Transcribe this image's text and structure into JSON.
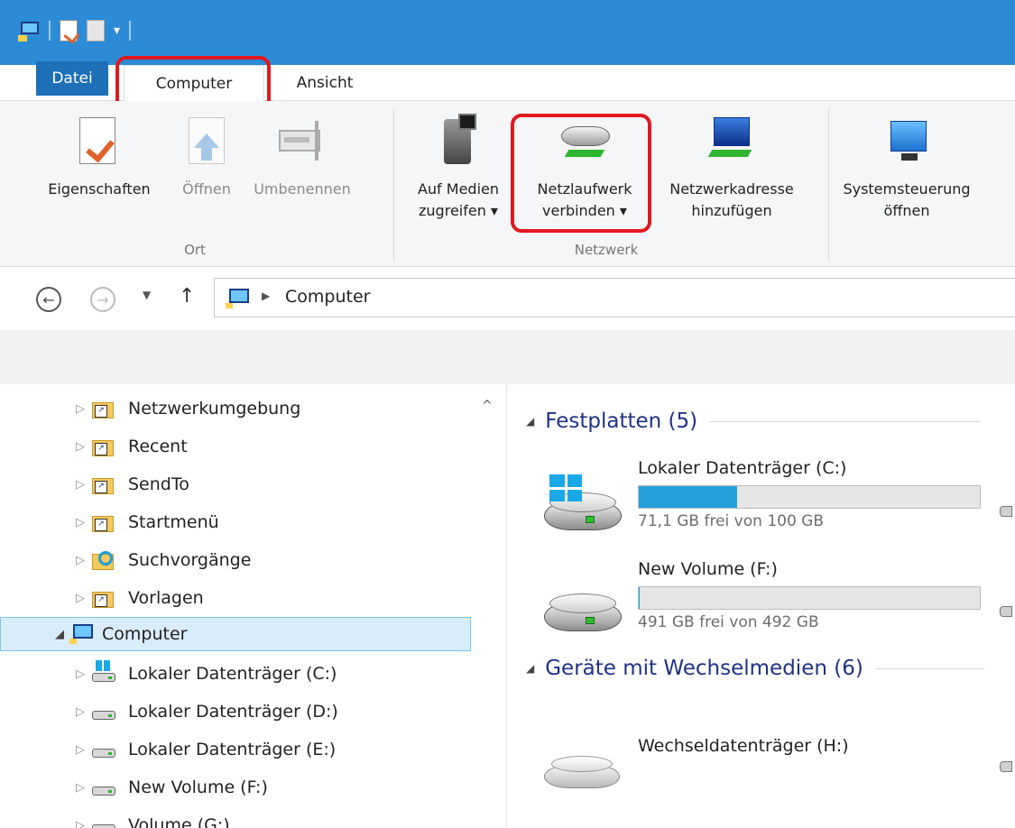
{
  "ribbon_tabs": {
    "datei": "Datei",
    "computer": "Computer",
    "ansicht": "Ansicht"
  },
  "ribbon": {
    "ort": {
      "label": "Ort",
      "buttons": [
        {
          "line1": "Eigenschaften",
          "line2": "",
          "icon": "properties-icon",
          "enabled": true
        },
        {
          "line1": "Öffnen",
          "line2": "",
          "icon": "open-icon",
          "enabled": false
        },
        {
          "line1": "Umbenennen",
          "line2": "",
          "icon": "rename-icon",
          "enabled": false
        }
      ]
    },
    "netzwerk": {
      "label": "Netzwerk",
      "buttons": [
        {
          "line1": "Auf Medien",
          "line2": "zugreifen ▾",
          "icon": "media-access-icon"
        },
        {
          "line1": "Netzlaufwerk",
          "line2": "verbinden ▾",
          "icon": "map-network-drive-icon"
        },
        {
          "line1": "Netzwerkadresse",
          "line2": "hinzufügen",
          "icon": "add-network-location-icon"
        }
      ]
    },
    "system": {
      "buttons": [
        {
          "line1": "Systemsteuerung",
          "line2": "öffnen",
          "icon": "control-panel-icon"
        }
      ]
    }
  },
  "address": {
    "path": "Computer"
  },
  "nav_tree": [
    {
      "label": "Netzwerkumgebung",
      "icon": "shortcut-folder-icon"
    },
    {
      "label": "Recent",
      "icon": "shortcut-folder-icon"
    },
    {
      "label": "SendTo",
      "icon": "shortcut-folder-icon"
    },
    {
      "label": "Startmenü",
      "icon": "shortcut-folder-icon"
    },
    {
      "label": "Suchvorgänge",
      "icon": "search-folder-icon"
    },
    {
      "label": "Vorlagen",
      "icon": "shortcut-folder-icon"
    },
    {
      "label": "Computer",
      "icon": "computer-icon",
      "selected": true
    },
    {
      "label": "Lokaler Datenträger (C:)",
      "icon": "windows-drive-icon"
    },
    {
      "label": "Lokaler Datenträger (D:)",
      "icon": "drive-icon"
    },
    {
      "label": "Lokaler Datenträger (E:)",
      "icon": "drive-icon"
    },
    {
      "label": "New Volume (F:)",
      "icon": "drive-icon"
    },
    {
      "label": "Volume (G:)",
      "icon": "drive-icon"
    }
  ],
  "content": {
    "groups": [
      {
        "title": "Festplatten (5)",
        "drives": [
          {
            "name": "Lokaler Datenträger (C:)",
            "free": "71,1 GB frei von 100 GB",
            "used_fraction": 0.289
          },
          {
            "name": "New Volume (F:)",
            "free": "491 GB frei von 492 GB",
            "used_fraction": 0.002
          }
        ]
      },
      {
        "title": "Geräte mit Wechselmedien (6)",
        "drives": [
          {
            "name": "Wechseldatenträger (H:)"
          }
        ]
      }
    ]
  },
  "colors": {
    "title_bar": "#2b8bd6",
    "file_tab": "#1d6fb8",
    "highlight": "#e0191f",
    "usage_bar": "#26a0da",
    "group_title": "#1e3287"
  }
}
